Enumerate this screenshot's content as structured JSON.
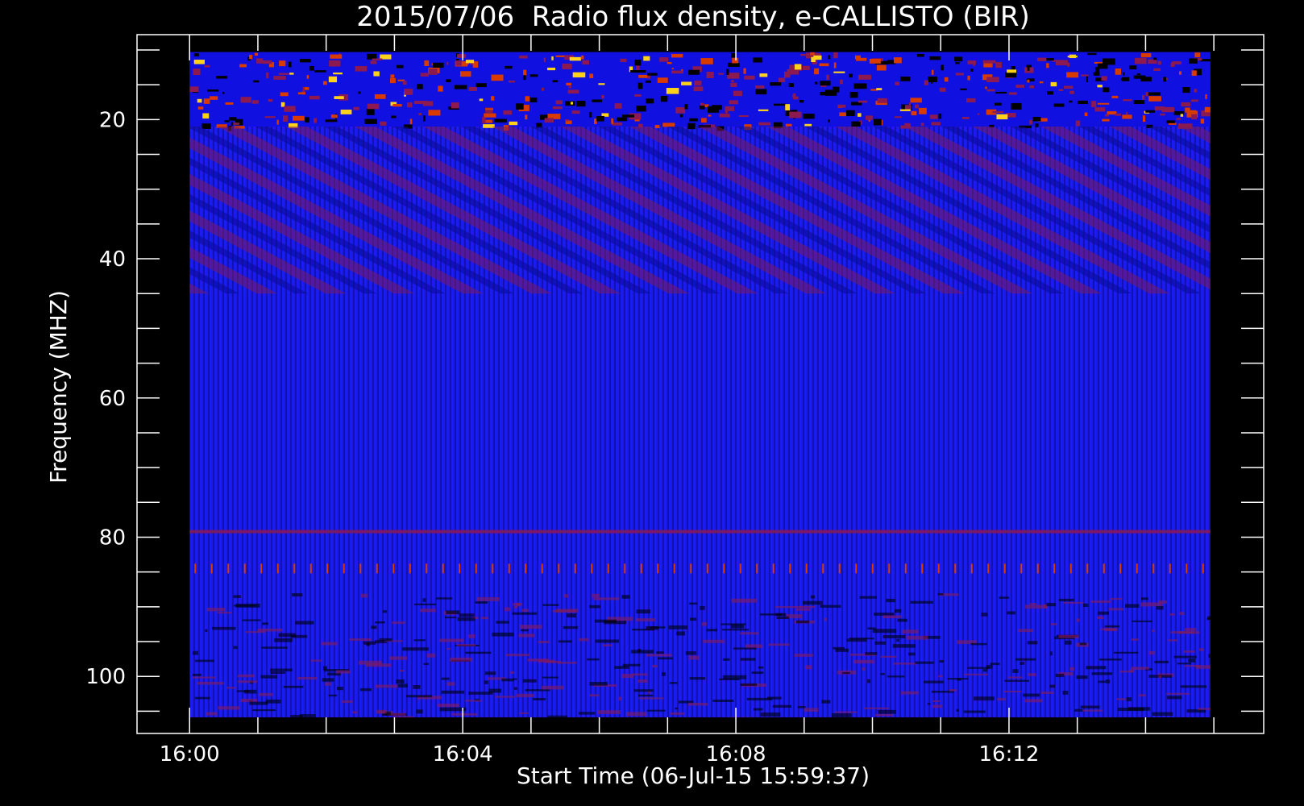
{
  "chart_data": {
    "type": "heatmap",
    "title": "2015/07/06  Radio flux density, e-CALLISTO (BIR)",
    "xlabel": "Start Time (06-Jul-15 15:59:37)",
    "ylabel": "Frequency (MHZ)",
    "x_ticks": [
      "16:00",
      "16:04",
      "16:08",
      "16:12"
    ],
    "x_tick_minutes": [
      0,
      4,
      8,
      12
    ],
    "x_range_minutes": [
      -0.77,
      15.73
    ],
    "x_data_range_minutes": [
      0,
      14.95
    ],
    "y_ticks": [
      20,
      40,
      60,
      80,
      100
    ],
    "y_range": [
      7.8,
      108.2
    ],
    "y_data_range": [
      10.3,
      105.9
    ],
    "y_reversed": true,
    "colormap": [
      "#000000",
      "#1010e0",
      "#2a2af5",
      "#8c1a50",
      "#d83a00",
      "#ffd21a"
    ],
    "background_color": "#1a1af0",
    "features": [
      {
        "kind": "band",
        "freq_min": 10.3,
        "freq_max": 21,
        "intensity": "high"
      },
      {
        "kind": "drifting_stripes",
        "freq_min": 21,
        "freq_max": 45,
        "intensity": "medium"
      },
      {
        "kind": "line",
        "freq": 79.2,
        "intensity": "medium"
      },
      {
        "kind": "periodic_ticks",
        "freq": 84.5,
        "intensity": "medium"
      },
      {
        "kind": "band",
        "freq_min": 88,
        "freq_max": 105.9,
        "intensity": "medium"
      }
    ]
  }
}
